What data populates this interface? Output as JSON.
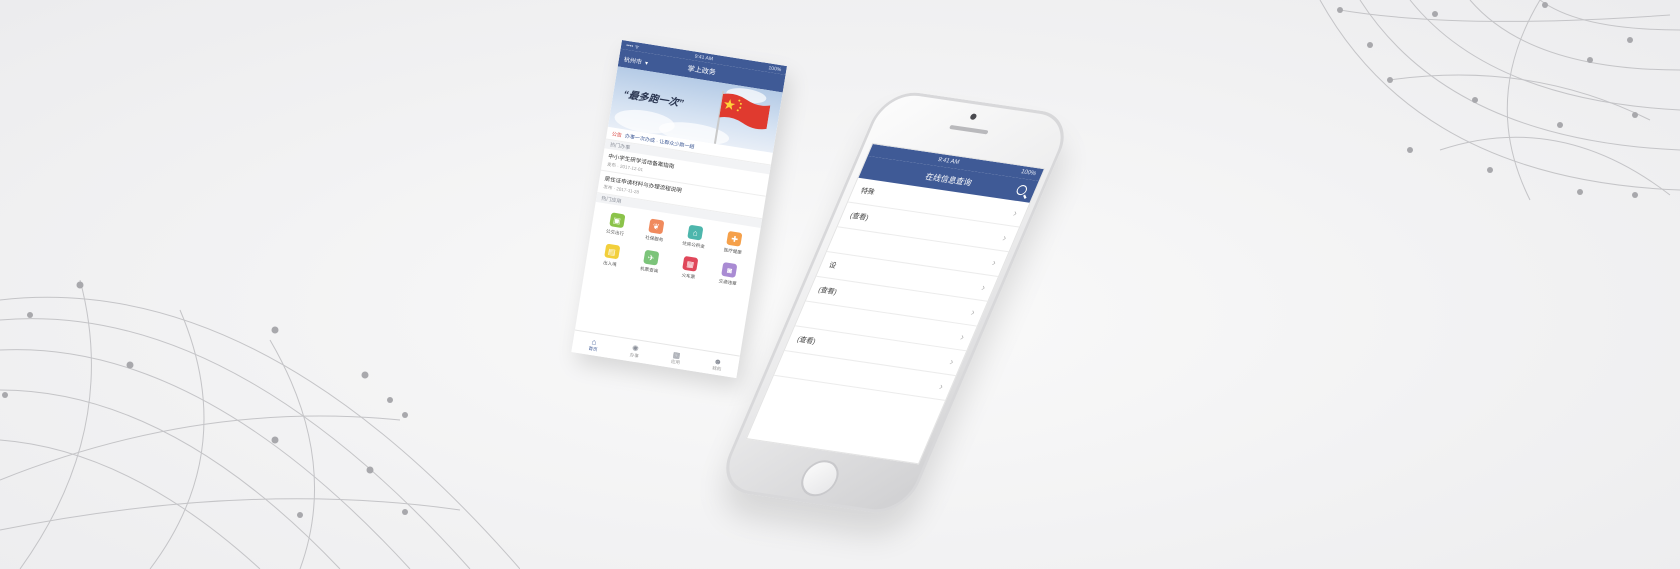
{
  "colors": {
    "brand": "#3f5a96",
    "accent_red": "#d9443f",
    "background": "#f3f3f4"
  },
  "back_phone": {
    "status": {
      "carrier": "",
      "time": "9:41 AM",
      "battery": "100%"
    },
    "nav_title": "在线信息查询",
    "search_icon": "search-icon",
    "rows": [
      {
        "label": "特殊",
        "chevron": "›"
      },
      {
        "label": "(查看)",
        "chevron": "›"
      },
      {
        "label": "",
        "chevron": "›"
      },
      {
        "label": "设",
        "chevron": "›"
      },
      {
        "label": "(查看)",
        "chevron": "›"
      },
      {
        "label": "",
        "chevron": "›"
      },
      {
        "label": "(查看)",
        "chevron": "›"
      },
      {
        "label": "",
        "chevron": "›"
      }
    ]
  },
  "front_screen": {
    "status": {
      "signal": "•••• ᯤ",
      "time": "9:41 AM",
      "battery": "100%"
    },
    "nav": {
      "city": "杭州市",
      "caret": "▼",
      "title": "掌上政务"
    },
    "banner": {
      "slogan": "“最多跑一次”"
    },
    "notice": {
      "tag": "公告",
      "text": "办事一次办成 · 让群众少跑一趟"
    },
    "section_news": "热门办事",
    "news": [
      {
        "title": "中小学生研学活动备案指南",
        "meta": "发布 · 2017-12-01"
      },
      {
        "title": "居住证申请材料与办理流程说明",
        "meta": "发布 · 2017-11-28"
      }
    ],
    "section_services": "热门应用",
    "services": [
      {
        "label": "公交出行",
        "icon": "bus-icon",
        "glyph": "▣",
        "color": "#8bc34a"
      },
      {
        "label": "社保服务",
        "icon": "hand-heart-icon",
        "glyph": "❦",
        "color": "#f08a5d"
      },
      {
        "label": "住房公积金",
        "icon": "house-icon",
        "glyph": "⌂",
        "color": "#4db6ac"
      },
      {
        "label": "医疗健康",
        "icon": "medical-kit-icon",
        "glyph": "✚",
        "color": "#f5a04a"
      },
      {
        "label": "出入境",
        "icon": "card-icon",
        "glyph": "▤",
        "color": "#f2cf3b"
      },
      {
        "label": "机票查询",
        "icon": "plane-icon",
        "glyph": "✈",
        "color": "#7cc47a"
      },
      {
        "label": "火车票",
        "icon": "train-icon",
        "glyph": "▦",
        "color": "#e0475a"
      },
      {
        "label": "交通违章",
        "icon": "car-icon",
        "glyph": "◙",
        "color": "#a98bd3"
      }
    ],
    "tabs": [
      {
        "label": "首页",
        "icon": "home-icon",
        "glyph": "⌂",
        "active": true
      },
      {
        "label": "办事",
        "icon": "gear-icon",
        "glyph": "✺",
        "active": false
      },
      {
        "label": "应用",
        "icon": "grid-icon",
        "glyph": "▦",
        "active": false
      },
      {
        "label": "我的",
        "icon": "user-icon",
        "glyph": "☻",
        "active": false
      }
    ]
  }
}
